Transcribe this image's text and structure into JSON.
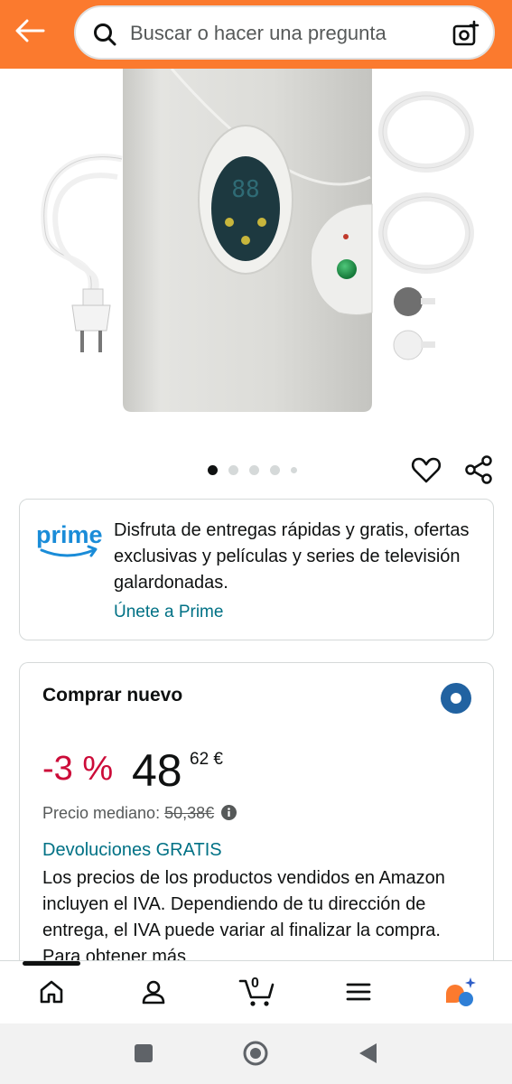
{
  "header": {
    "back_icon": "arrow-left-icon",
    "search_placeholder": "Buscar o hacer una pregunta",
    "search_icon": "search-icon",
    "camera_icon": "camera-search-icon",
    "accent_color": "#fb7a2e"
  },
  "carousel": {
    "total_dots": 5,
    "active_index": 0
  },
  "prime": {
    "logo_text": "prime",
    "description": "Disfruta de entregas rápidas y gratis, ofertas exclusivas y películas y series de televisión galardonadas.",
    "link": "Únete a Prime"
  },
  "buy": {
    "title": "Comprar nuevo",
    "discount": "-3 %",
    "price_whole": "48",
    "price_fraction": "62 €",
    "median_label": "Precio mediano:",
    "median_price": "50,38€",
    "returns": "Devoluciones GRATIS",
    "iva_text": "Los precios de los productos vendidos en Amazon incluyen el IVA. Dependiendo de tu dirección de entrega, el IVA puede variar al finalizar la compra. Para obtener más"
  },
  "bottom_nav": {
    "items": [
      "home-icon",
      "account-icon",
      "cart-icon",
      "menu-icon",
      "assistant-icon"
    ],
    "cart_count": "0"
  },
  "system_nav": {
    "items": [
      "recent-apps-icon",
      "home-circle-icon",
      "back-triangle-icon"
    ]
  }
}
